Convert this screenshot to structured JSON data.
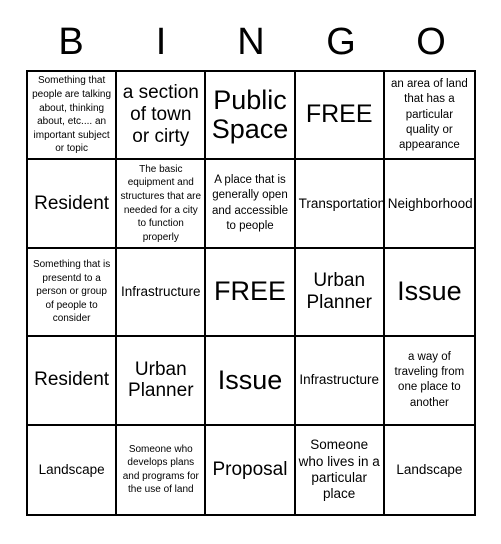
{
  "header": {
    "letters": [
      "B",
      "I",
      "N",
      "G",
      "O"
    ]
  },
  "grid": {
    "columns": 5,
    "rows": 5,
    "cells": [
      {
        "text": "Something that people are talking about, thinking about, etc.... an important subject or topic",
        "size": "xxs"
      },
      {
        "text": "a section of town or cirty",
        "size": "md"
      },
      {
        "text": "Public Space",
        "size": "xl"
      },
      {
        "text": "FREE",
        "size": "lg"
      },
      {
        "text": "an area of land that has a particular quality or appearance",
        "size": "xs"
      },
      {
        "text": "Resident",
        "size": "md"
      },
      {
        "text": "The basic equipment and structures that are needed for a city to function properly",
        "size": "xxs"
      },
      {
        "text": "A place that is generally open and accessible to people",
        "size": "xs"
      },
      {
        "text": "Transportation",
        "size": "sm"
      },
      {
        "text": "Neighborhood",
        "size": "sm"
      },
      {
        "text": "Something that is presentd to a person or group of people to consider",
        "size": "xxs"
      },
      {
        "text": "Infrastructure",
        "size": "sm"
      },
      {
        "text": "FREE",
        "size": "xl"
      },
      {
        "text": "Urban Planner",
        "size": "md"
      },
      {
        "text": "Issue",
        "size": "xl"
      },
      {
        "text": "Resident",
        "size": "md"
      },
      {
        "text": "Urban Planner",
        "size": "md"
      },
      {
        "text": "Issue",
        "size": "xl"
      },
      {
        "text": "Infrastructure",
        "size": "sm"
      },
      {
        "text": "a way of traveling from one place to another",
        "size": "xs"
      },
      {
        "text": "Landscape",
        "size": "sm"
      },
      {
        "text": "Someone who develops plans and programs for the use of land",
        "size": "xxs"
      },
      {
        "text": "Proposal",
        "size": "md"
      },
      {
        "text": "Someone who lives in a particular place",
        "size": "sm"
      },
      {
        "text": "Landscape",
        "size": "sm"
      }
    ]
  },
  "colors": {
    "background": "#ffffff",
    "ink": "#000000",
    "border": "#000000"
  }
}
